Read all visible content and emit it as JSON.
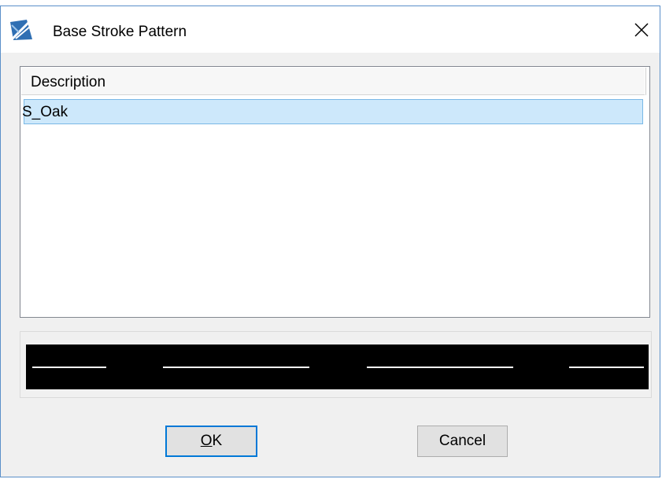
{
  "dialog": {
    "title": "Base Stroke Pattern",
    "app_icon": "app-logo-icon",
    "close_icon": "close-icon",
    "accent_color": "#0078d7"
  },
  "list": {
    "columns": [
      "Description"
    ],
    "rows": [
      {
        "description": "S_Oak",
        "selected": true
      }
    ],
    "selected_row_color": "#cde8fb"
  },
  "preview": {
    "background_color": "#000000",
    "stroke_color": "#ffffff"
  },
  "buttons": {
    "ok_mnemonic": "O",
    "ok_rest": "K",
    "cancel_label": "Cancel"
  }
}
